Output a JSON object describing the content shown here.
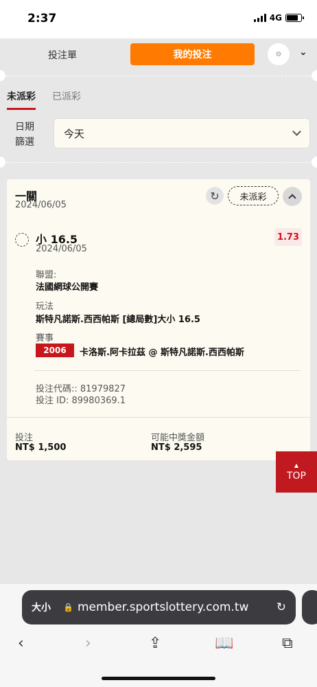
{
  "status": {
    "time": "2:37",
    "network": "4G"
  },
  "header": {
    "tab_slip": "投注單",
    "tab_my_bets": "我的投注"
  },
  "subtabs": {
    "unsettled": "未派彩",
    "settled": "已派彩"
  },
  "filter": {
    "label_line1": "日期",
    "label_line2": "篩選",
    "value": "今天"
  },
  "bet": {
    "type": "一關",
    "date": "2024/06/05",
    "status_pill": "未派彩",
    "selection": "小 16.5",
    "selection_date": "2024/06/05",
    "odds": "1.73",
    "league_label": "聯盟:",
    "league_value": "法國網球公開賽",
    "market_label": "玩法",
    "market_value": "斯特凡諾斯.西西帕斯 [總局數]大小 16.5",
    "event_label": "賽事",
    "event_id": "2006",
    "event_teams": "卡洛斯.阿卡拉茲 @ 斯特凡諾斯.西西帕斯",
    "bet_code": "投注代碼:: 81979827",
    "bet_id": "投注 ID: 89980369.1",
    "stake_label": "投注",
    "stake_value": "NT$ 1,500",
    "payout_label": "可能中獎金額",
    "payout_value": "NT$ 2,595"
  },
  "top_button": "TOP",
  "browser": {
    "text_size": "大小",
    "url": "member.sportslottery.com.tw"
  }
}
